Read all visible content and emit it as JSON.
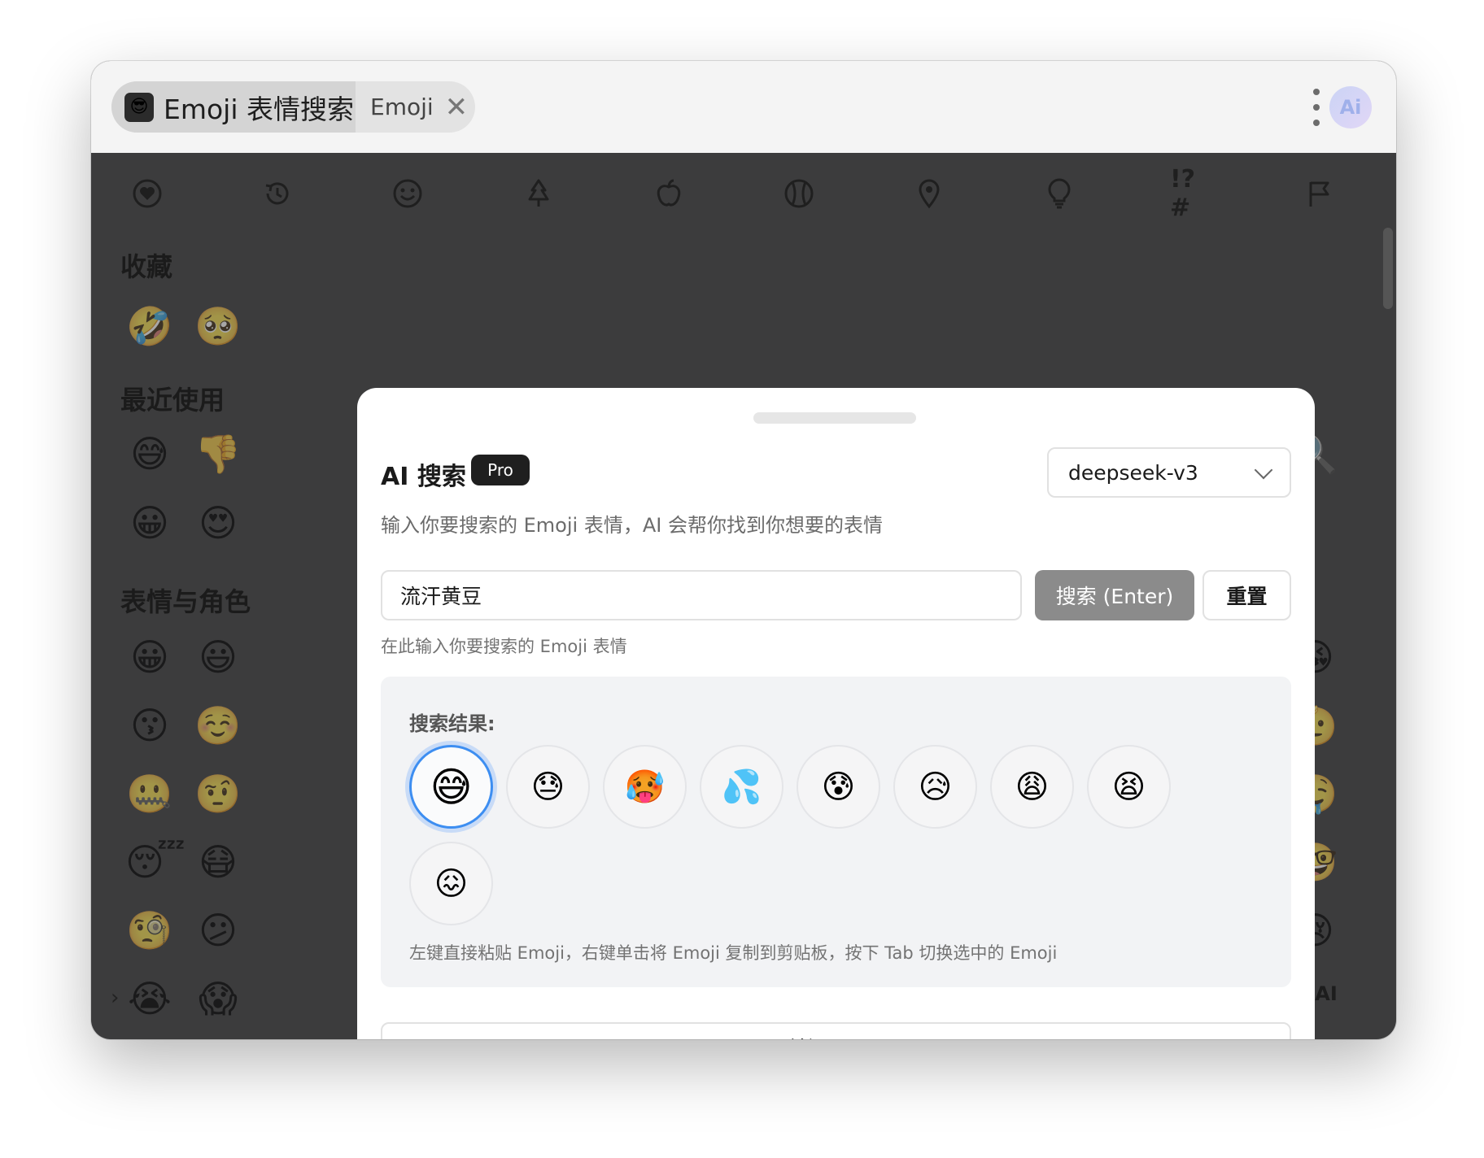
{
  "window": {
    "tab_title": "Emoji 表情搜索",
    "tab_icon": "😎",
    "tab_sub_label": "Emoji",
    "avatar_text": "Ai"
  },
  "toolbar": {
    "icons": [
      "favorites-heart-icon",
      "history-clock-icon",
      "smiley-icon",
      "tree-nature-icon",
      "apple-food-icon",
      "ball-activity-icon",
      "map-pin-travel-icon",
      "lightbulb-objects-icon",
      "symbols-icon",
      "flag-icon"
    ],
    "symbols_label": "!?#"
  },
  "background": {
    "favorites_label": "收藏",
    "recent_label": "最近使用",
    "smileys_label": "表情与角色",
    "ask_ai_label": "去问 AI"
  },
  "dialog": {
    "title": "AI 搜索",
    "badge": "Pro",
    "model": "deepseek-v3",
    "description": "输入你要搜索的 Emoji 表情，AI 会帮你找到你想要的表情",
    "search_value": "流汗黄豆",
    "search_button": "搜索 (Enter)",
    "reset_button": "重置",
    "input_help": "在此输入你要搜索的 Emoji 表情",
    "results_title": "搜索结果:",
    "results": [
      "😅",
      "😓",
      "🥵",
      "💦",
      "😰",
      "😥",
      "😩",
      "😫",
      "😖"
    ],
    "selected_index": 0,
    "results_help": "左键直接粘贴 Emoji，右键单击将 Emoji 复制到剪贴板，按下 Tab 切换选中的 Emoji",
    "close_button": "关闭 (Esc)"
  },
  "colors": {
    "accent": "#3d8ef1",
    "primary_button": "#8b8b8b",
    "badge": "#1f1f1f"
  }
}
